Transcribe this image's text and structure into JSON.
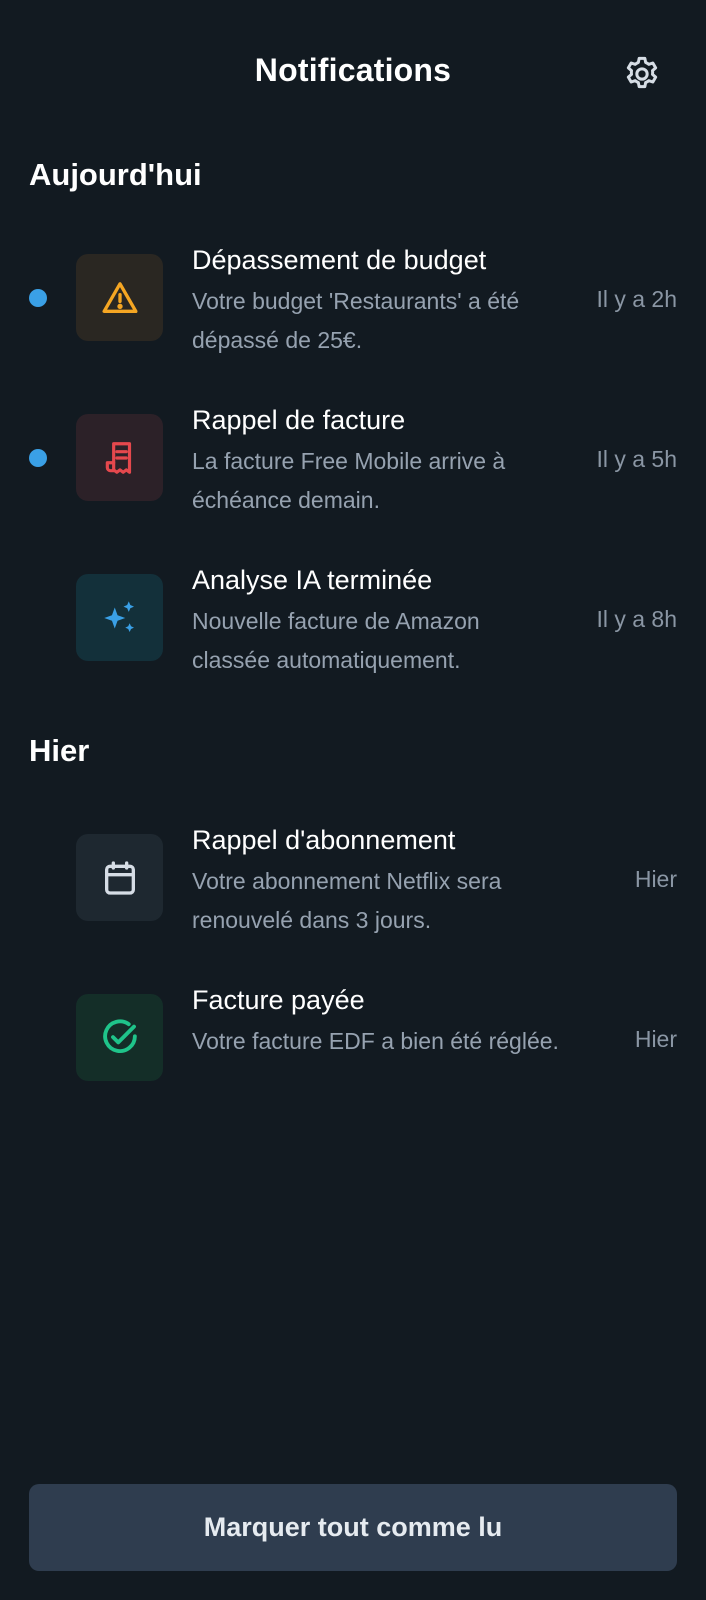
{
  "header": {
    "title": "Notifications",
    "settings_icon": "gear-icon"
  },
  "sections": [
    {
      "title": "Aujourd'hui",
      "items": [
        {
          "title": "Dépassement de budget",
          "body": "Votre budget 'Restaurants' a été dépassé de 25€.",
          "time": "Il y a 2h",
          "unread": true,
          "icon": "warning-triangle-icon",
          "icon_color": "#f5a623",
          "tile_color": "#2a2722"
        },
        {
          "title": "Rappel de facture",
          "body": "La facture Free Mobile arrive à échéance demain.",
          "time": "Il y a 5h",
          "unread": true,
          "icon": "receipt-icon",
          "icon_color": "#e5484d",
          "tile_color": "#2c2128"
        },
        {
          "title": "Analyse IA terminée",
          "body": "Nouvelle facture de Amazon classée automatiquement.",
          "time": "Il y a 8h",
          "unread": false,
          "icon": "sparkles-icon",
          "icon_color": "#3aa0e6",
          "tile_color": "#13303a"
        }
      ]
    },
    {
      "title": "Hier",
      "items": [
        {
          "title": "Rappel d'abonnement",
          "body": "Votre abonnement Netflix sera renouvelé dans 3 jours.",
          "time": "Hier",
          "unread": false,
          "icon": "calendar-icon",
          "icon_color": "#d6dde5",
          "tile_color": "#1e2830"
        },
        {
          "title": "Facture payée",
          "body": "Votre facture EDF a bien été réglée.",
          "time": "Hier",
          "unread": false,
          "icon": "check-circle-icon",
          "icon_color": "#1fc48a",
          "tile_color": "#142e28"
        }
      ]
    }
  ],
  "footer": {
    "mark_all_label": "Marquer tout comme lu"
  },
  "colors": {
    "background": "#121a21",
    "accent_unread": "#3aa0e6",
    "button_bg": "#2f3d4f"
  }
}
